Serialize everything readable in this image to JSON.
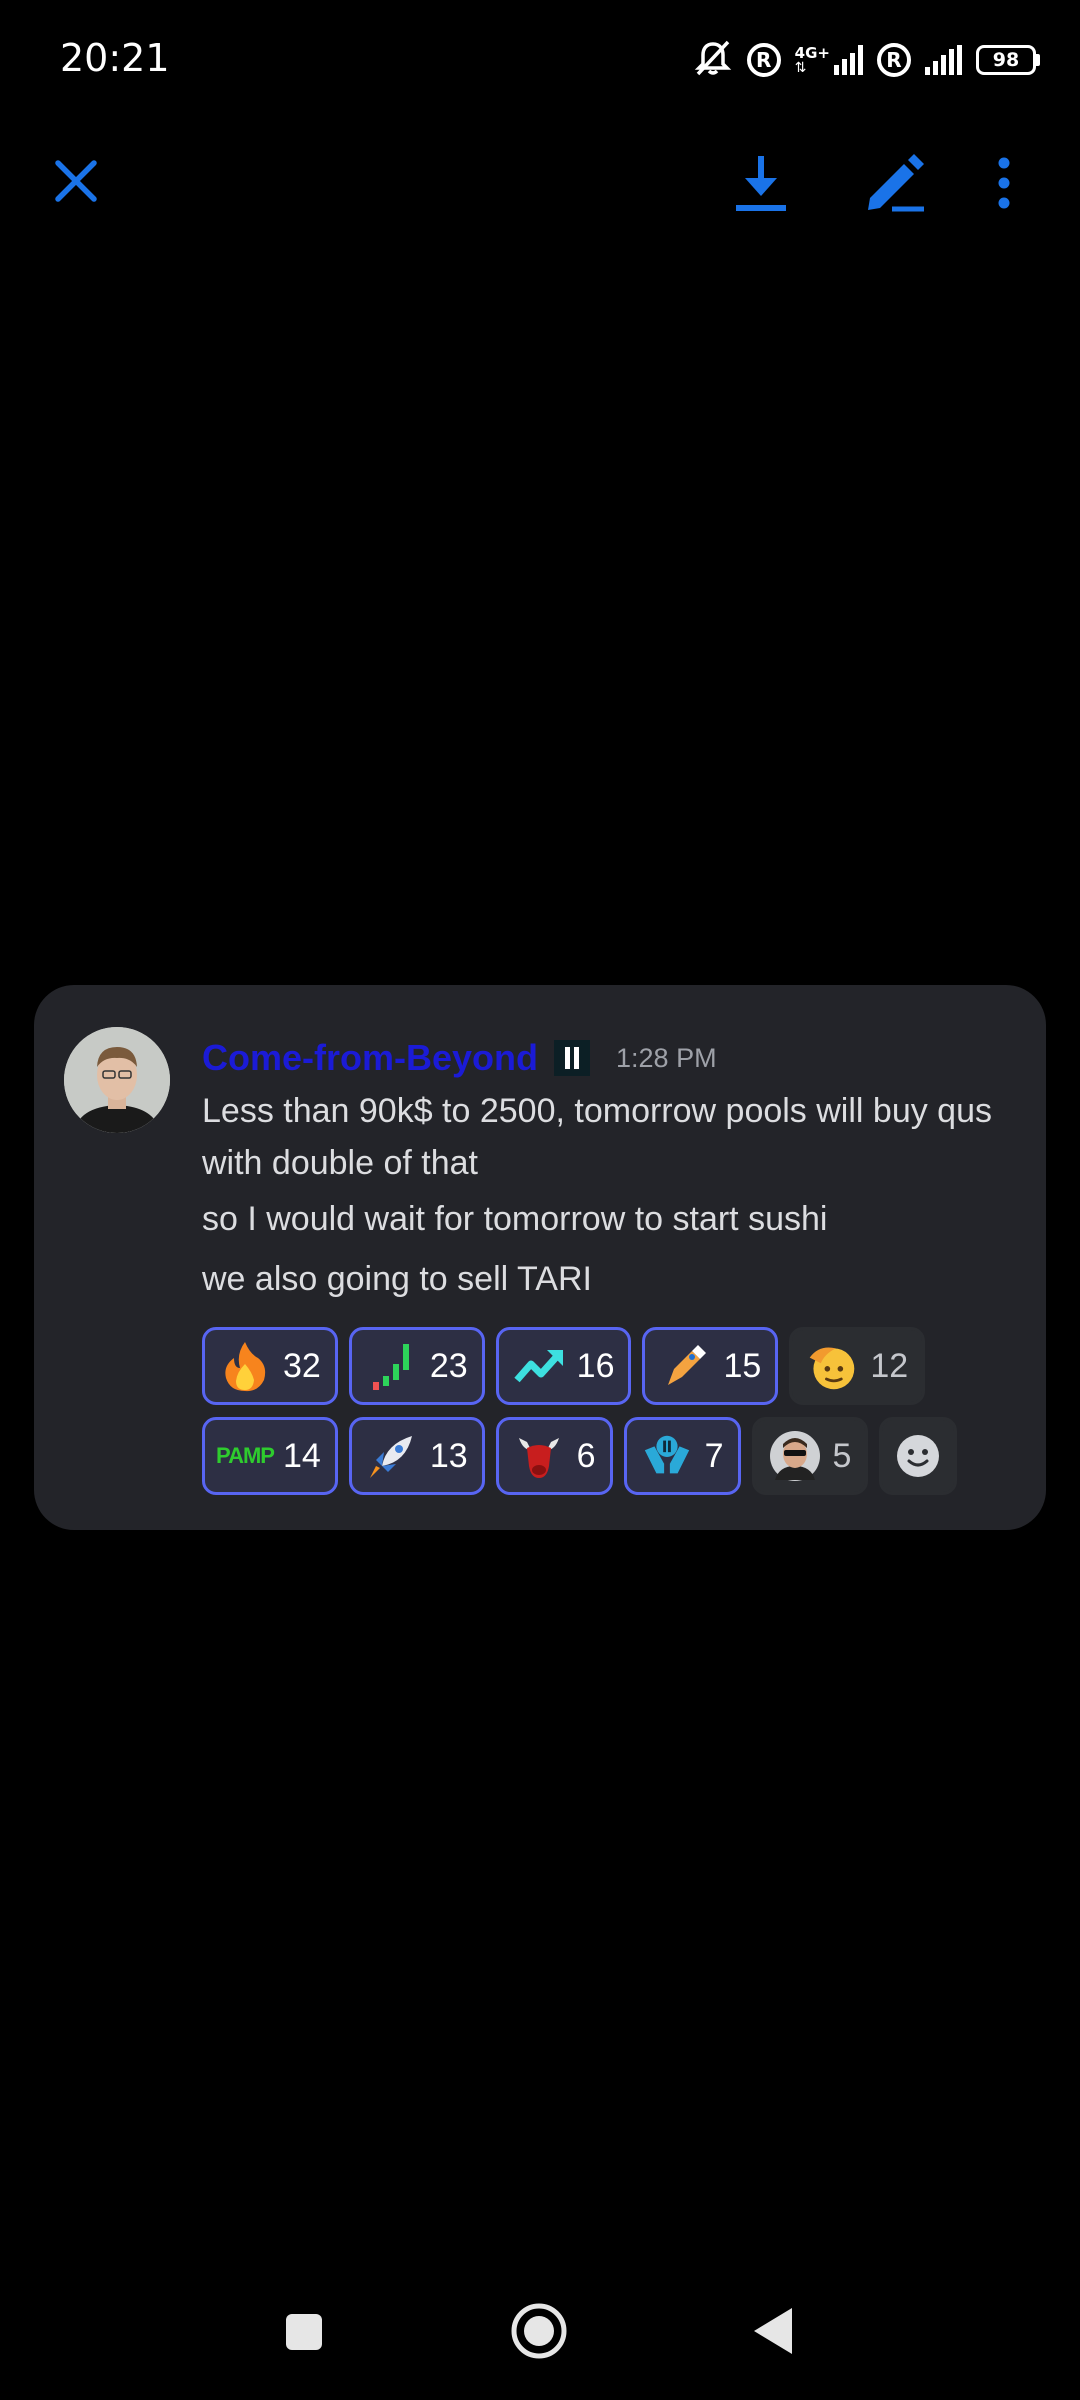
{
  "status_bar": {
    "time": "20:21",
    "network_label_top": "4G+",
    "battery": "98",
    "icons": [
      "mute-bell-icon",
      "registered-icon",
      "signal-icon",
      "registered-icon",
      "signal-icon",
      "battery-icon"
    ]
  },
  "toolbar": {
    "icons": [
      "close-icon",
      "download-icon",
      "edit-icon",
      "more-vertical-icon"
    ],
    "accent_color": "#1a73e8"
  },
  "message": {
    "author": "Come-from-Beyond",
    "author_color": "#1b1bd6",
    "timestamp": "1:28 PM",
    "lines": [
      "Less than 90k$ to 2500, tomorrow pools will buy qus with double of that",
      "so I would wait for tomorrow to start sushi",
      "we also going to sell TARI"
    ]
  },
  "reactions": [
    {
      "emoji": "fire-emoji",
      "count": "32",
      "active": true
    },
    {
      "emoji": "green-bars-emoji",
      "count": "23",
      "active": true
    },
    {
      "emoji": "trending-up-emoji",
      "count": "16",
      "active": true
    },
    {
      "emoji": "pen-emoji",
      "count": "15",
      "active": true
    },
    {
      "emoji": "saluting-face-emoji",
      "count": "12",
      "active": false
    },
    {
      "emoji": "pamp-emoji",
      "label": "PAMP",
      "count": "14",
      "active": true
    },
    {
      "emoji": "rocket-emoji",
      "count": "13",
      "active": true
    },
    {
      "emoji": "bull-emoji",
      "count": "6",
      "active": true
    },
    {
      "emoji": "hands-coin-emoji",
      "count": "7",
      "active": true
    },
    {
      "emoji": "avatar-emoji",
      "count": "5",
      "active": false
    }
  ],
  "nav_bar": {
    "icons": [
      "recents-icon",
      "home-icon",
      "back-icon"
    ]
  }
}
